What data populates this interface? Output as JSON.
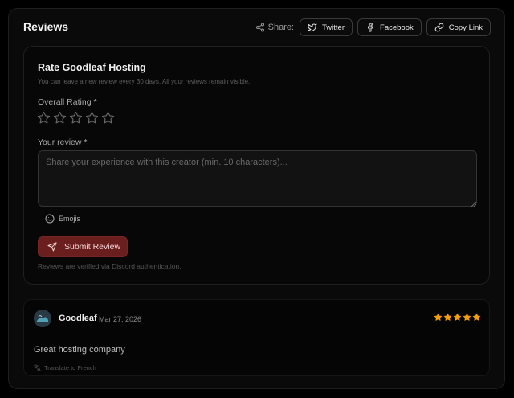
{
  "header": {
    "title": "Reviews",
    "share_label": "Share:",
    "buttons": {
      "twitter": "Twitter",
      "facebook": "Facebook",
      "copy_link": "Copy Link"
    }
  },
  "form": {
    "title": "Rate Goodleaf Hosting",
    "subtitle": "You can leave a new review every 30 days. All your reviews remain visible.",
    "rating_label": "Overall Rating *",
    "rating_value": 0,
    "rating_max": 5,
    "review_label": "Your review *",
    "review_placeholder": "Share your experience with this creator (min. 10 characters)...",
    "review_value": "",
    "emoji_label": "Emojis",
    "submit_label": "Submit Review",
    "verify_note": "Reviews are verified via Discord authentication."
  },
  "reviews": [
    {
      "author": "Goodleaf",
      "date": "Mar 27, 2026",
      "rating": 5,
      "text": "Great hosting company",
      "translate_label": "Translate to French"
    }
  ],
  "colors": {
    "accent_submit": "#6b1e1e",
    "star_filled": "#f59e0b",
    "background": "#000000"
  }
}
